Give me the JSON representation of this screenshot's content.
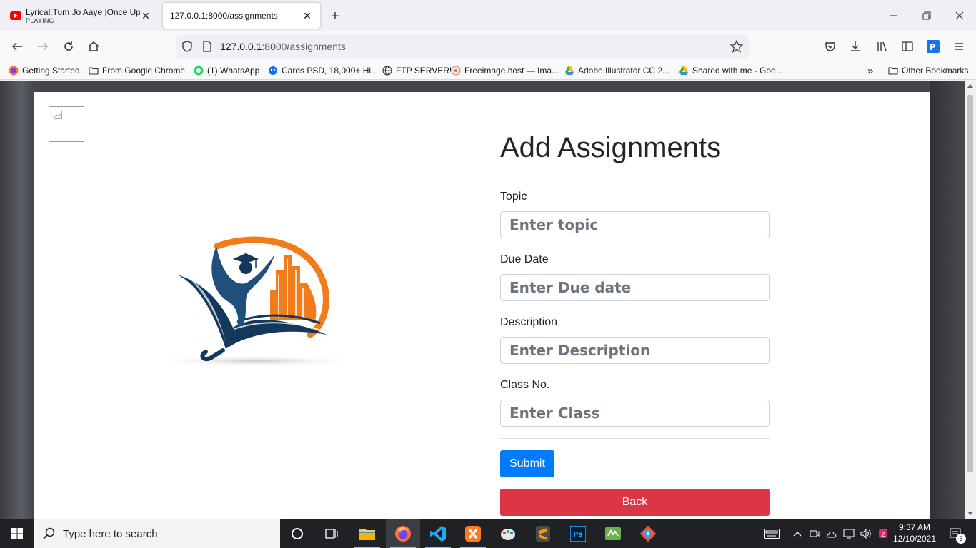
{
  "browser": {
    "tabs": [
      {
        "title": "Lyrical:Tum Jo Aaye |Once Upon",
        "subtitle": "PLAYING",
        "active": false
      },
      {
        "title": "127.0.0.1:8000/assignments",
        "subtitle": "",
        "active": true
      }
    ],
    "url_host": "127.0.0.1",
    "url_rest": ":8000/assignments",
    "new_tab": "+",
    "close_glyph": "✕",
    "window_controls": {
      "minimize": "—",
      "maximize": "❐",
      "close": "✕"
    }
  },
  "bookmarks": [
    {
      "label": "Getting Started",
      "icon": "firefox-icon"
    },
    {
      "label": "From Google Chrome",
      "icon": "folder-icon"
    },
    {
      "label": "(1) WhatsApp",
      "icon": "whatsapp-icon"
    },
    {
      "label": "Cards PSD, 18,000+ Hi...",
      "icon": "freepik-icon"
    },
    {
      "label": "FTP SERVER!",
      "icon": "globe-icon"
    },
    {
      "label": "Freeimage.host — Ima...",
      "icon": "freeimage-icon"
    },
    {
      "label": "Adobe Illustrator CC 2...",
      "icon": "google-drive-icon"
    },
    {
      "label": "Shared with me - Goo...",
      "icon": "google-drive-icon"
    }
  ],
  "bookmarks_overflow": "»",
  "other_bookmarks": "Other Bookmarks",
  "form": {
    "title": "Add Assignments",
    "fields": [
      {
        "label": "Topic",
        "placeholder": "Enter topic",
        "value": ""
      },
      {
        "label": "Due Date",
        "placeholder": "Enter Due date",
        "value": ""
      },
      {
        "label": "Description",
        "placeholder": "Enter Description",
        "value": ""
      },
      {
        "label": "Class No.",
        "placeholder": "Enter Class",
        "value": ""
      }
    ],
    "submit_label": "Submit",
    "back_label": "Back"
  },
  "colors": {
    "submit": "#007bff",
    "back": "#dc3545",
    "logo_orange": "#f07c1b",
    "logo_navy": "#14385c"
  },
  "taskbar": {
    "search_placeholder": "Type here to search",
    "apps": [
      "cortana-icon",
      "task-view-icon",
      "file-explorer-icon",
      "firefox-icon",
      "vscode-icon",
      "xampp-icon",
      "paint-icon",
      "sublime-text-icon",
      "photoshop-icon",
      "app-icon",
      "git-icon"
    ],
    "time": "9:37 AM",
    "date": "12/10/2021",
    "notifications": "5"
  }
}
